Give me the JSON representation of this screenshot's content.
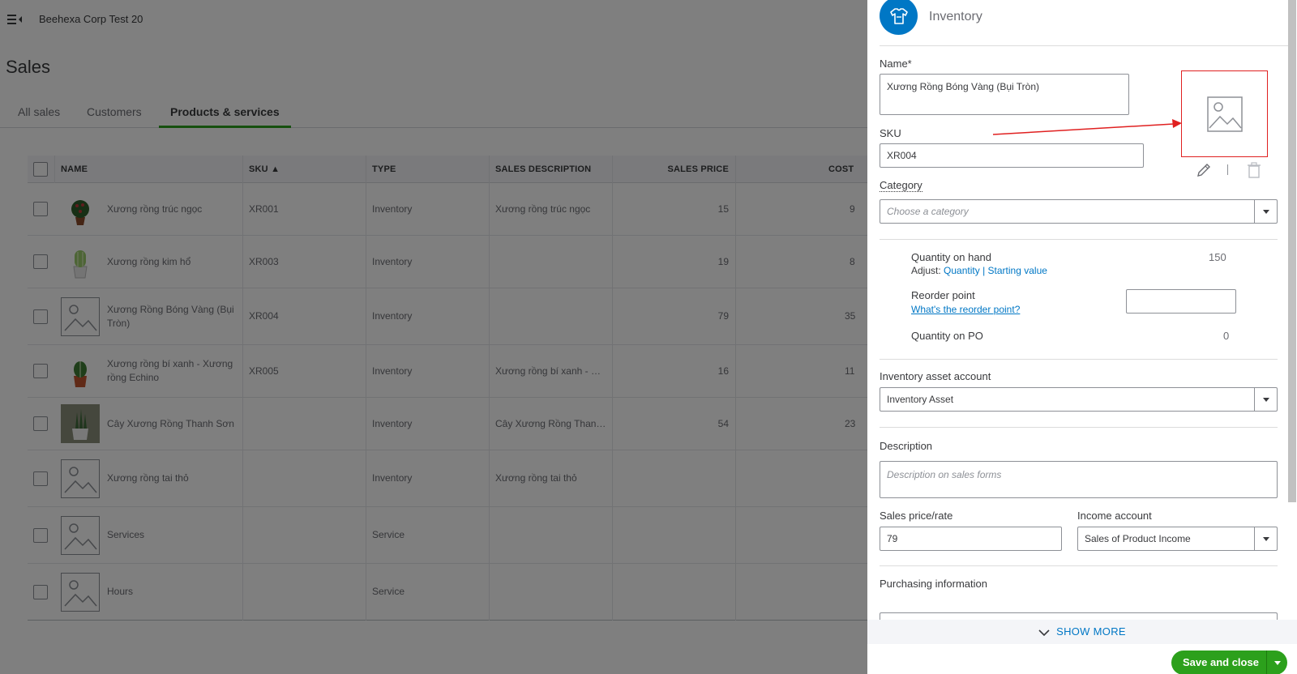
{
  "header": {
    "company_name": "Beehexa Corp Test 20"
  },
  "page": {
    "title": "Sales"
  },
  "tabs": [
    {
      "label": "All sales"
    },
    {
      "label": "Customers"
    },
    {
      "label": "Products & services",
      "active": true
    }
  ],
  "table": {
    "columns": {
      "name": "NAME",
      "sku": "SKU ▲",
      "type": "TYPE",
      "description": "SALES DESCRIPTION",
      "price": "SALES PRICE",
      "cost": "COST"
    },
    "rows": [
      {
        "name": "Xương rồng trúc ngọc",
        "sku": "XR001",
        "type": "Inventory",
        "description": "Xương rồng trúc ngọc",
        "price": "15",
        "cost": "9",
        "thumb": "cactus-photo-icon"
      },
      {
        "name": "Xương rồng kim hổ",
        "sku": "XR003",
        "type": "Inventory",
        "description": "",
        "price": "19",
        "cost": "8",
        "thumb": "cactus-photo-icon"
      },
      {
        "name": "Xương Rồng Bóng Vàng (Bụi Tròn)",
        "sku": "XR004",
        "type": "Inventory",
        "description": "",
        "price": "79",
        "cost": "35",
        "thumb": "image-placeholder-icon"
      },
      {
        "name": "Xương rồng bí xanh - Xương rồng Echino",
        "sku": "XR005",
        "type": "Inventory",
        "description": "Xương rồng bí xanh - …",
        "price": "16",
        "cost": "11",
        "thumb": "cactus-photo-icon"
      },
      {
        "name": "Cây Xương Rồng Thanh Sơn",
        "sku": "",
        "type": "Inventory",
        "description": "Cây Xương Rồng Than…",
        "price": "54",
        "cost": "23",
        "thumb": "cactus-photo-icon"
      },
      {
        "name": "Xương rồng tai thỏ",
        "sku": "",
        "type": "Inventory",
        "description": "Xương rồng tai thỏ",
        "price": "",
        "cost": "",
        "thumb": "image-placeholder-icon"
      },
      {
        "name": "Services",
        "sku": "",
        "type": "Service",
        "description": "",
        "price": "",
        "cost": "",
        "thumb": "image-placeholder-icon"
      },
      {
        "name": "Hours",
        "sku": "",
        "type": "Service",
        "description": "",
        "price": "",
        "cost": "",
        "thumb": "image-placeholder-icon"
      }
    ]
  },
  "drawer": {
    "type_label": "Inventory",
    "name_label": "Name*",
    "name_value": "Xương Rồng Bóng Vàng (Bụi Tròn)",
    "sku_label": "SKU",
    "sku_value": "XR004",
    "category_label": "Category",
    "category_placeholder": "Choose a category",
    "qty_on_hand_label": "Quantity on hand",
    "qty_on_hand_value": "150",
    "adjust_label": "Adjust:",
    "adjust_quantity": "Quantity",
    "adjust_sep": "|",
    "adjust_starting": "Starting value",
    "reorder_label": "Reorder point",
    "reorder_link": "What's the reorder point?",
    "qty_po_label": "Quantity on PO",
    "qty_po_value": "0",
    "asset_account_label": "Inventory asset account",
    "asset_account_value": "Inventory Asset",
    "description_label": "Description",
    "description_placeholder": "Description on sales forms",
    "price_label": "Sales price/rate",
    "price_value": "79",
    "income_label": "Income account",
    "income_value": "Sales of Product Income",
    "purchasing_label": "Purchasing information",
    "show_more": "SHOW MORE",
    "save_label": "Save and close"
  },
  "colors": {
    "accent_green": "#2ca01c",
    "link_blue": "#0077c5",
    "annotation_red": "#e02020"
  }
}
